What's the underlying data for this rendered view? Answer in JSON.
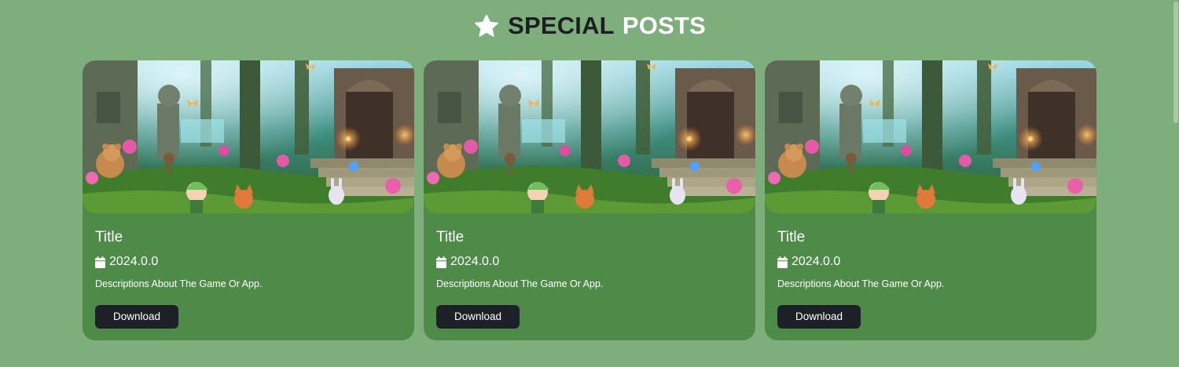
{
  "header": {
    "icon": "star-icon",
    "title_part1": "SPECIAL",
    "title_part2": "POSTS",
    "colors": {
      "dark": "#1c1f22",
      "light": "#ffffff"
    }
  },
  "theme": {
    "page_background": "#7fae7d",
    "card_background": "#4e8b48",
    "button_background": "#1d2027"
  },
  "cards": [
    {
      "title": "Title",
      "date_icon": "calendar-icon",
      "date": "2024.0.0",
      "description": "Descriptions About The Game Or App.",
      "button_label": "Download"
    },
    {
      "title": "Title",
      "date_icon": "calendar-icon",
      "date": "2024.0.0",
      "description": "Descriptions About The Game Or App.",
      "button_label": "Download"
    },
    {
      "title": "Title",
      "date_icon": "calendar-icon",
      "date": "2024.0.0",
      "description": "Descriptions About The Game Or App.",
      "button_label": "Download"
    }
  ]
}
